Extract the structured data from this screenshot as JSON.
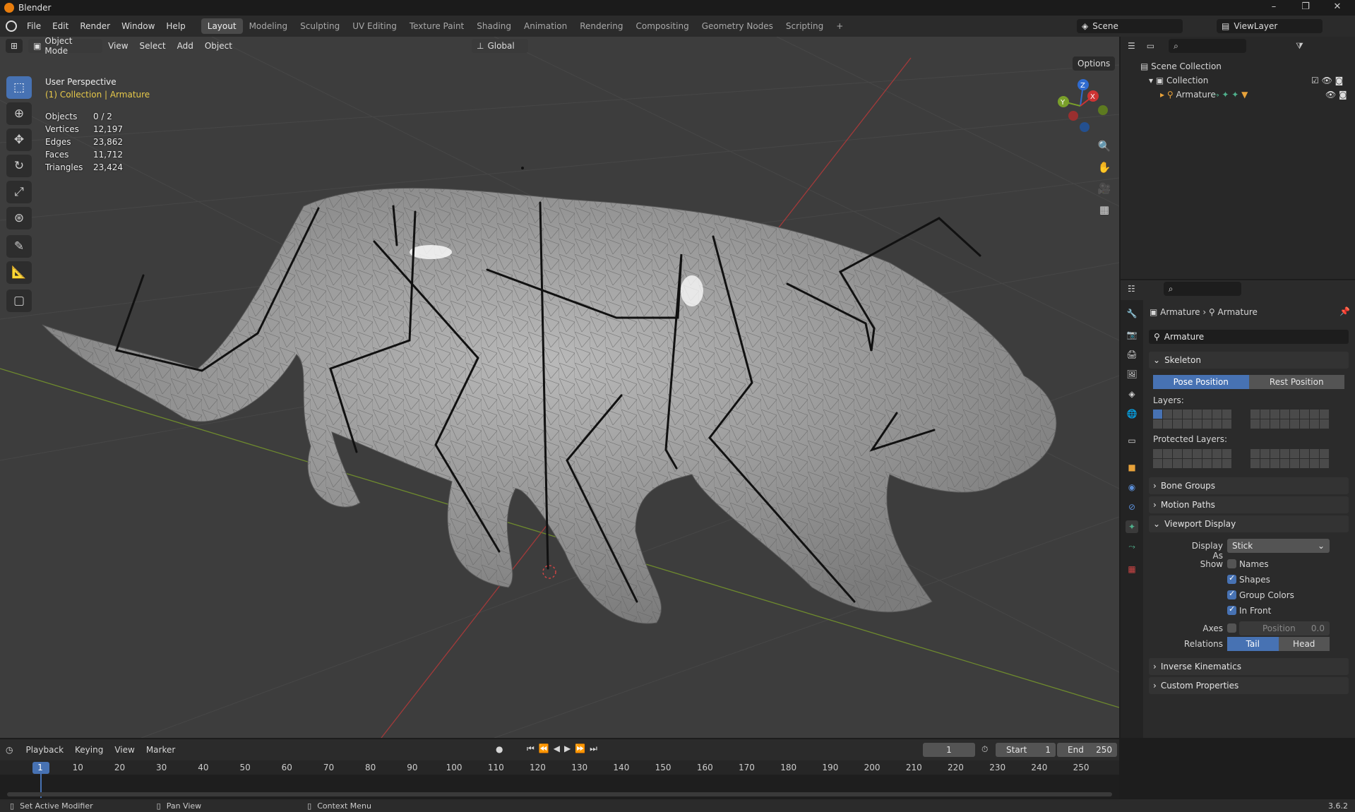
{
  "app": {
    "title": "Blender",
    "version": "3.6.2",
    "window_controls": [
      "–",
      "❐",
      "✕"
    ]
  },
  "menu": {
    "items": [
      "File",
      "Edit",
      "Render",
      "Window",
      "Help"
    ],
    "workspaces": [
      "Layout",
      "Modeling",
      "Sculpting",
      "UV Editing",
      "Texture Paint",
      "Shading",
      "Animation",
      "Rendering",
      "Compositing",
      "Geometry Nodes",
      "Scripting",
      "+"
    ],
    "active_workspace": "Layout",
    "scene": "Scene",
    "view_layer": "ViewLayer"
  },
  "viewport": {
    "mode": "Object Mode",
    "menus": [
      "View",
      "Select",
      "Add",
      "Object"
    ],
    "transform": "Global",
    "options": "Options",
    "view_name": "User Perspective",
    "collection_info": "(1) Collection | Armature",
    "stats": [
      {
        "k": "Objects",
        "v": "0 / 2"
      },
      {
        "k": "Vertices",
        "v": "12,197"
      },
      {
        "k": "Edges",
        "v": "23,862"
      },
      {
        "k": "Faces",
        "v": "11,712"
      },
      {
        "k": "Triangles",
        "v": "23,424"
      }
    ],
    "tools": [
      "select-box",
      "cursor",
      "move",
      "rotate",
      "scale",
      "transform",
      "annotate",
      "measure",
      "add-cube"
    ],
    "gizmo_axes": [
      "X",
      "Y",
      "Z"
    ]
  },
  "outliner": {
    "root": "Scene Collection",
    "collection": "Collection",
    "object": "Armature"
  },
  "properties": {
    "breadcrumb": [
      "Armature",
      "Armature"
    ],
    "data_name": "Armature",
    "skeleton": "Skeleton",
    "pose_position": "Pose Position",
    "rest_position": "Rest Position",
    "layers_label": "Layers:",
    "protected_label": "Protected Layers:",
    "bone_groups": "Bone Groups",
    "motion_paths": "Motion Paths",
    "viewport_display": "Viewport Display",
    "display_as_label": "Display As",
    "display_as": "Stick",
    "show_label": "Show",
    "show_items": [
      {
        "label": "Names",
        "checked": false
      },
      {
        "label": "Shapes",
        "checked": true
      },
      {
        "label": "Group Colors",
        "checked": true
      },
      {
        "label": "In Front",
        "checked": true
      }
    ],
    "axes_label": "Axes",
    "axes_position_label": "Position",
    "axes_position_value": "0.0",
    "relations_label": "Relations",
    "relations_tail": "Tail",
    "relations_head": "Head",
    "inverse_kinematics": "Inverse Kinematics",
    "custom_properties": "Custom Properties"
  },
  "timeline": {
    "menus": [
      "Playback",
      "Keying",
      "View",
      "Marker"
    ],
    "current_frame": "1",
    "start_label": "Start",
    "start": "1",
    "end_label": "End",
    "end": "250",
    "ticks": [
      "1",
      "10",
      "20",
      "30",
      "40",
      "50",
      "60",
      "70",
      "80",
      "90",
      "100",
      "110",
      "120",
      "130",
      "140",
      "150",
      "160",
      "170",
      "180",
      "190",
      "200",
      "210",
      "220",
      "230",
      "240",
      "250"
    ]
  },
  "status": {
    "left": "Set Active Modifier",
    "middle": "Pan View",
    "right": "Context Menu"
  }
}
